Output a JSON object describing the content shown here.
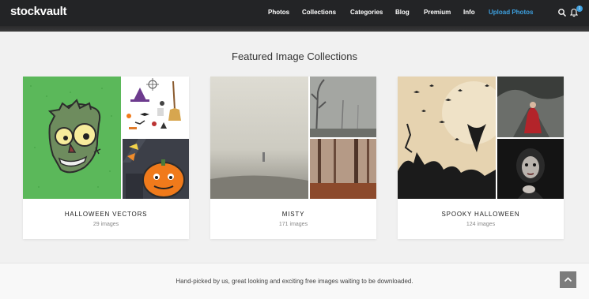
{
  "header": {
    "logo": "stockvault",
    "nav": [
      "Photos",
      "Collections",
      "Categories",
      "Blog",
      "Premium",
      "Info",
      "Upload Photos"
    ],
    "notification_count": "1"
  },
  "main": {
    "title": "Featured Image Collections",
    "collections": [
      {
        "name": "HALLOWEEN VECTORS",
        "count": "29 images"
      },
      {
        "name": "MISTY",
        "count": "171 images"
      },
      {
        "name": "SPOOKY HALLOWEEN",
        "count": "124 images"
      }
    ]
  },
  "footer": {
    "text": "Hand-picked by us, great looking and exciting free images waiting to be downloaded."
  },
  "colors": {
    "nav_bg": "#232426",
    "accent": "#3ea1e0",
    "page_bg": "#f1f1f1"
  }
}
